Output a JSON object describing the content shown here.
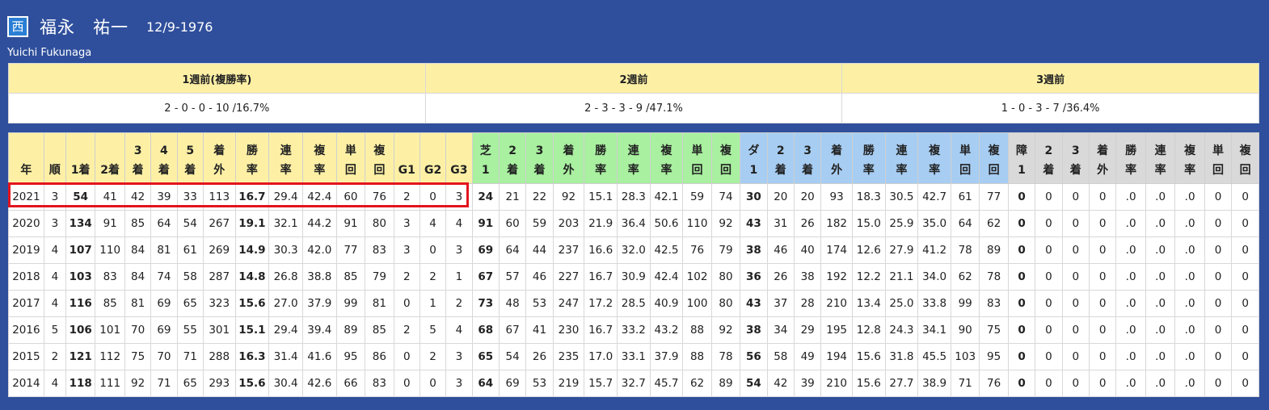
{
  "jockey": {
    "region_badge": "西",
    "name_jp": "福永　祐一",
    "birthdate": "12/9-1976",
    "name_en": "Yuichi Fukunaga"
  },
  "weekly": {
    "headers": [
      "1週前(複勝率)",
      "2週前",
      "3週前"
    ],
    "values": [
      "2 - 0 - 0 - 10 /16.7%",
      "2 - 3 - 3 - 9 /47.1%",
      "1 - 0 - 3 - 7 /36.4%"
    ]
  },
  "stats": {
    "headers": [
      {
        "label": "年",
        "group": "y"
      },
      {
        "label": "順",
        "group": "y"
      },
      {
        "label": "1着",
        "group": "y"
      },
      {
        "label": "2着",
        "group": "y"
      },
      {
        "label": "3\n着",
        "group": "y"
      },
      {
        "label": "4\n着",
        "group": "y"
      },
      {
        "label": "5\n着",
        "group": "y"
      },
      {
        "label": "着\n外",
        "group": "y"
      },
      {
        "label": "勝\n率",
        "group": "y"
      },
      {
        "label": "連\n率",
        "group": "y"
      },
      {
        "label": "複\n率",
        "group": "y"
      },
      {
        "label": "単\n回",
        "group": "y"
      },
      {
        "label": "複\n回",
        "group": "y"
      },
      {
        "label": "G1",
        "group": "y"
      },
      {
        "label": "G2",
        "group": "y"
      },
      {
        "label": "G3",
        "group": "y"
      },
      {
        "label": "芝\n1",
        "group": "g"
      },
      {
        "label": "2\n着",
        "group": "g"
      },
      {
        "label": "3\n着",
        "group": "g"
      },
      {
        "label": "着\n外",
        "group": "g"
      },
      {
        "label": "勝\n率",
        "group": "g"
      },
      {
        "label": "連\n率",
        "group": "g"
      },
      {
        "label": "複\n率",
        "group": "g"
      },
      {
        "label": "単\n回",
        "group": "g"
      },
      {
        "label": "複\n回",
        "group": "g"
      },
      {
        "label": "ダ\n1",
        "group": "b"
      },
      {
        "label": "2\n着",
        "group": "b"
      },
      {
        "label": "3\n着",
        "group": "b"
      },
      {
        "label": "着\n外",
        "group": "b"
      },
      {
        "label": "勝\n率",
        "group": "b"
      },
      {
        "label": "連\n率",
        "group": "b"
      },
      {
        "label": "複\n率",
        "group": "b"
      },
      {
        "label": "単\n回",
        "group": "b"
      },
      {
        "label": "複\n回",
        "group": "b"
      },
      {
        "label": "障\n1",
        "group": "x"
      },
      {
        "label": "2\n着",
        "group": "x"
      },
      {
        "label": "3\n着",
        "group": "x"
      },
      {
        "label": "着\n外",
        "group": "x"
      },
      {
        "label": "勝\n率",
        "group": "x"
      },
      {
        "label": "連\n率",
        "group": "x"
      },
      {
        "label": "複\n率",
        "group": "x"
      },
      {
        "label": "単\n回",
        "group": "x"
      },
      {
        "label": "複\n回",
        "group": "x"
      }
    ],
    "bold_columns": [
      2,
      8,
      16,
      25,
      34
    ],
    "highlighted_row_index": 0,
    "rows": [
      [
        "2021",
        "3",
        "54",
        "41",
        "42",
        "39",
        "33",
        "113",
        "16.7",
        "29.4",
        "42.4",
        "60",
        "76",
        "2",
        "0",
        "3",
        "24",
        "21",
        "22",
        "92",
        "15.1",
        "28.3",
        "42.1",
        "59",
        "74",
        "30",
        "20",
        "20",
        "93",
        "18.3",
        "30.5",
        "42.7",
        "61",
        "77",
        "0",
        "0",
        "0",
        "0",
        ".0",
        ".0",
        ".0",
        "0",
        "0"
      ],
      [
        "2020",
        "3",
        "134",
        "91",
        "85",
        "64",
        "54",
        "267",
        "19.1",
        "32.1",
        "44.2",
        "91",
        "80",
        "3",
        "4",
        "4",
        "91",
        "60",
        "59",
        "203",
        "21.9",
        "36.4",
        "50.6",
        "110",
        "92",
        "43",
        "31",
        "26",
        "182",
        "15.0",
        "25.9",
        "35.0",
        "64",
        "62",
        "0",
        "0",
        "0",
        "0",
        ".0",
        ".0",
        ".0",
        "0",
        "0"
      ],
      [
        "2019",
        "4",
        "107",
        "110",
        "84",
        "81",
        "61",
        "269",
        "14.9",
        "30.3",
        "42.0",
        "77",
        "83",
        "3",
        "0",
        "3",
        "69",
        "64",
        "44",
        "237",
        "16.6",
        "32.0",
        "42.5",
        "76",
        "79",
        "38",
        "46",
        "40",
        "174",
        "12.6",
        "27.9",
        "41.2",
        "78",
        "89",
        "0",
        "0",
        "0",
        "0",
        ".0",
        ".0",
        ".0",
        "0",
        "0"
      ],
      [
        "2018",
        "4",
        "103",
        "83",
        "84",
        "74",
        "58",
        "287",
        "14.8",
        "26.8",
        "38.8",
        "85",
        "79",
        "2",
        "2",
        "1",
        "67",
        "57",
        "46",
        "227",
        "16.7",
        "30.9",
        "42.4",
        "102",
        "80",
        "36",
        "26",
        "38",
        "192",
        "12.2",
        "21.1",
        "34.0",
        "62",
        "78",
        "0",
        "0",
        "0",
        "0",
        ".0",
        ".0",
        ".0",
        "0",
        "0"
      ],
      [
        "2017",
        "4",
        "116",
        "85",
        "81",
        "69",
        "65",
        "323",
        "15.6",
        "27.0",
        "37.9",
        "99",
        "81",
        "0",
        "1",
        "2",
        "73",
        "48",
        "53",
        "247",
        "17.2",
        "28.5",
        "40.9",
        "100",
        "80",
        "43",
        "37",
        "28",
        "210",
        "13.4",
        "25.0",
        "33.8",
        "99",
        "83",
        "0",
        "0",
        "0",
        "0",
        ".0",
        ".0",
        ".0",
        "0",
        "0"
      ],
      [
        "2016",
        "5",
        "106",
        "101",
        "70",
        "69",
        "55",
        "301",
        "15.1",
        "29.4",
        "39.4",
        "89",
        "85",
        "2",
        "5",
        "4",
        "68",
        "67",
        "41",
        "230",
        "16.7",
        "33.2",
        "43.2",
        "88",
        "92",
        "38",
        "34",
        "29",
        "195",
        "12.8",
        "24.3",
        "34.1",
        "90",
        "75",
        "0",
        "0",
        "0",
        "0",
        ".0",
        ".0",
        ".0",
        "0",
        "0"
      ],
      [
        "2015",
        "2",
        "121",
        "112",
        "75",
        "70",
        "71",
        "288",
        "16.3",
        "31.4",
        "41.6",
        "95",
        "86",
        "0",
        "2",
        "3",
        "65",
        "54",
        "26",
        "235",
        "17.0",
        "33.1",
        "37.9",
        "88",
        "78",
        "56",
        "58",
        "49",
        "194",
        "15.6",
        "31.8",
        "45.5",
        "103",
        "95",
        "0",
        "0",
        "0",
        "0",
        ".0",
        ".0",
        ".0",
        "0",
        "0"
      ],
      [
        "2014",
        "4",
        "118",
        "111",
        "92",
        "71",
        "65",
        "293",
        "15.6",
        "30.4",
        "42.6",
        "66",
        "83",
        "0",
        "0",
        "3",
        "64",
        "69",
        "53",
        "219",
        "15.7",
        "32.7",
        "45.7",
        "62",
        "89",
        "54",
        "42",
        "39",
        "210",
        "15.6",
        "27.7",
        "38.9",
        "71",
        "76",
        "0",
        "0",
        "0",
        "0",
        ".0",
        ".0",
        ".0",
        "0",
        "0"
      ]
    ]
  }
}
